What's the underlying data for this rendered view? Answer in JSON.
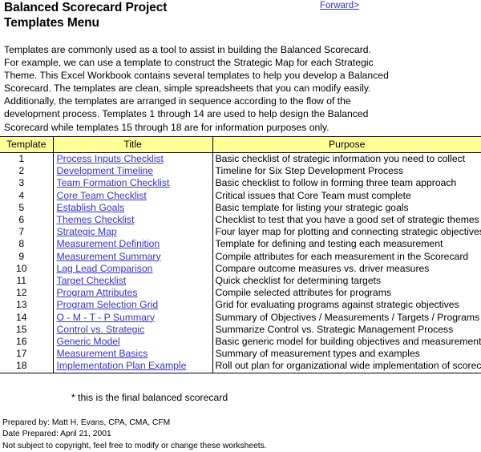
{
  "header": {
    "title": "Balanced Scorecard Project\nTemplates Menu",
    "forward_link": "Forward>",
    "link_color": "#3333cc"
  },
  "intro": {
    "paragraph": "Templates are commonly used as a tool to assist in building the Balanced Scorecard.\nFor example, we can use a template to construct the Strategic Map for each Strategic\nTheme. This Excel Workbook contains several templates to help you develop a Balanced\nScorecard. The templates are clean, simple spreadsheets that you can modify easily.\nAdditionally, the templates are arranged in sequence according to the flow of the\ndevelopment process. Templates 1 through 14 are used to help design the Balanced\nScorecard while templates 15 through 18 are for information purposes only."
  },
  "table": {
    "header_background": "#ffff99",
    "columns": [
      "Template",
      "Title",
      "Purpose"
    ],
    "rows": [
      {
        "num": "1",
        "title": "Process Inputs Checklist",
        "purpose": "Basic checklist of strategic information you need to collect"
      },
      {
        "num": "2",
        "title": "Development Timeline",
        "purpose": "Timeline for Six Step Development Process"
      },
      {
        "num": "3",
        "title": "Team Formation Checklist",
        "purpose": "Basic checklist to follow in forming three team approach"
      },
      {
        "num": "4",
        "title": "Core Team Checklist",
        "purpose": "Critical issues that Core Team must complete"
      },
      {
        "num": "5",
        "title": "Establish Goals",
        "purpose": "Basic template for listing your strategic goals"
      },
      {
        "num": "6",
        "title": "Themes Checklist",
        "purpose": "Checklist to test that you have a good set of strategic themes"
      },
      {
        "num": "7",
        "title": "Strategic Map",
        "purpose": "Four layer map for plotting and connecting strategic objectives"
      },
      {
        "num": "8",
        "title": "Measurement Definition",
        "purpose": "Template for defining and testing each measurement"
      },
      {
        "num": "9",
        "title": "Measurement Summary",
        "purpose": "Compile attributes for each measurement in the Scorecard"
      },
      {
        "num": "10",
        "title": "Lag Lead Comparison",
        "purpose": "Compare outcome measures vs. driver measures"
      },
      {
        "num": "11",
        "title": "Target Checklist",
        "purpose": "Quick checklist for determining targets"
      },
      {
        "num": "12",
        "title": "Program Attributes",
        "purpose": "Compile selected attributes for programs"
      },
      {
        "num": "13",
        "title": "Program Selection Grid",
        "purpose": "Grid for evaluating programs against strategic objectives"
      },
      {
        "num": "14",
        "title": "O - M - T - P Summary",
        "purpose": "Summary of Objectives / Measurements / Targets / Programs"
      },
      {
        "num": "15",
        "title": "Control vs. Strategic",
        "purpose": "Summarize Control vs. Strategic Management Process"
      },
      {
        "num": "16",
        "title": "Generic Model",
        "purpose": "Basic generic model for building objectives and measurements"
      },
      {
        "num": "17",
        "title": "Measurement Basics",
        "purpose": "Summary of measurement types and examples"
      },
      {
        "num": "18",
        "title": "Implementation Plan Example",
        "purpose": "Roll out plan for organizational wide implementation of scorecard"
      }
    ]
  },
  "final_note": "* this is the final balanced scorecard",
  "footer": {
    "prepared_by": "Prepared by: Matt H. Evans, CPA, CMA, CFM",
    "date_prepared": "Date Prepared: April 21, 2001",
    "copyright": "Not subject to copyright, feel free to modify or change these worksheets."
  }
}
